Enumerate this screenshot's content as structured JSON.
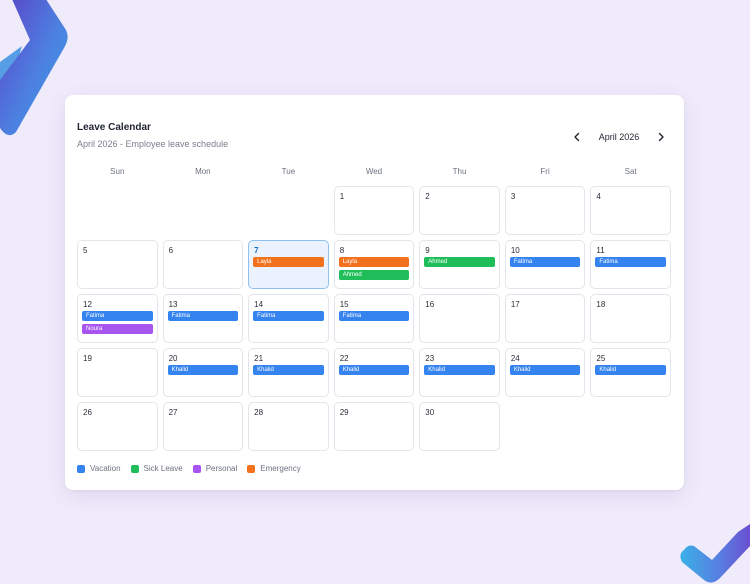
{
  "header": {
    "title": "Leave Calendar",
    "subtitle": "April 2026 - Employee leave schedule",
    "month_label": "April 2026",
    "prev_icon": "chevron-left-icon",
    "next_icon": "chevron-right-icon"
  },
  "colors": {
    "vacation": "#3583ef",
    "sick": "#1fbe5a",
    "personal": "#a855f0",
    "emergency": "#f2711c"
  },
  "weekdays": [
    "Sun",
    "Mon",
    "Tue",
    "Wed",
    "Thu",
    "Fri",
    "Sat"
  ],
  "calendar": {
    "leading_empty": 3,
    "today": 7,
    "days": [
      {
        "day": "1",
        "events": []
      },
      {
        "day": "2",
        "events": []
      },
      {
        "day": "3",
        "events": []
      },
      {
        "day": "4",
        "events": []
      },
      {
        "day": "5",
        "events": []
      },
      {
        "day": "6",
        "events": []
      },
      {
        "day": "7",
        "events": [
          {
            "name": "Layla",
            "type": "emergency"
          }
        ]
      },
      {
        "day": "8",
        "events": [
          {
            "name": "Layla",
            "type": "emergency"
          },
          {
            "name": "Ahmed",
            "type": "sick"
          }
        ]
      },
      {
        "day": "9",
        "events": [
          {
            "name": "Ahmed",
            "type": "sick"
          }
        ]
      },
      {
        "day": "10",
        "events": [
          {
            "name": "Fatima",
            "type": "vacation"
          }
        ]
      },
      {
        "day": "11",
        "events": [
          {
            "name": "Fatima",
            "type": "vacation"
          }
        ]
      },
      {
        "day": "12",
        "events": [
          {
            "name": "Fatima",
            "type": "vacation"
          },
          {
            "name": "Noura",
            "type": "personal"
          }
        ]
      },
      {
        "day": "13",
        "events": [
          {
            "name": "Fatima",
            "type": "vacation"
          }
        ]
      },
      {
        "day": "14",
        "events": [
          {
            "name": "Fatima",
            "type": "vacation"
          }
        ]
      },
      {
        "day": "15",
        "events": [
          {
            "name": "Fatima",
            "type": "vacation"
          }
        ]
      },
      {
        "day": "16",
        "events": []
      },
      {
        "day": "17",
        "events": []
      },
      {
        "day": "18",
        "events": []
      },
      {
        "day": "19",
        "events": []
      },
      {
        "day": "20",
        "events": [
          {
            "name": "Khalid",
            "type": "vacation"
          }
        ]
      },
      {
        "day": "21",
        "events": [
          {
            "name": "Khalid",
            "type": "vacation"
          }
        ]
      },
      {
        "day": "22",
        "events": [
          {
            "name": "Khalid",
            "type": "vacation"
          }
        ]
      },
      {
        "day": "23",
        "events": [
          {
            "name": "Khalid",
            "type": "vacation"
          }
        ]
      },
      {
        "day": "24",
        "events": [
          {
            "name": "Khalid",
            "type": "vacation"
          }
        ]
      },
      {
        "day": "25",
        "events": [
          {
            "name": "Khalid",
            "type": "vacation"
          }
        ]
      },
      {
        "day": "26",
        "events": []
      },
      {
        "day": "27",
        "events": []
      },
      {
        "day": "28",
        "events": []
      },
      {
        "day": "29",
        "events": []
      },
      {
        "day": "30",
        "events": []
      }
    ]
  },
  "legend": [
    {
      "label": "Vacation",
      "type": "vacation"
    },
    {
      "label": "Sick Leave",
      "type": "sick"
    },
    {
      "label": "Personal",
      "type": "personal"
    },
    {
      "label": "Emergency",
      "type": "emergency"
    }
  ]
}
